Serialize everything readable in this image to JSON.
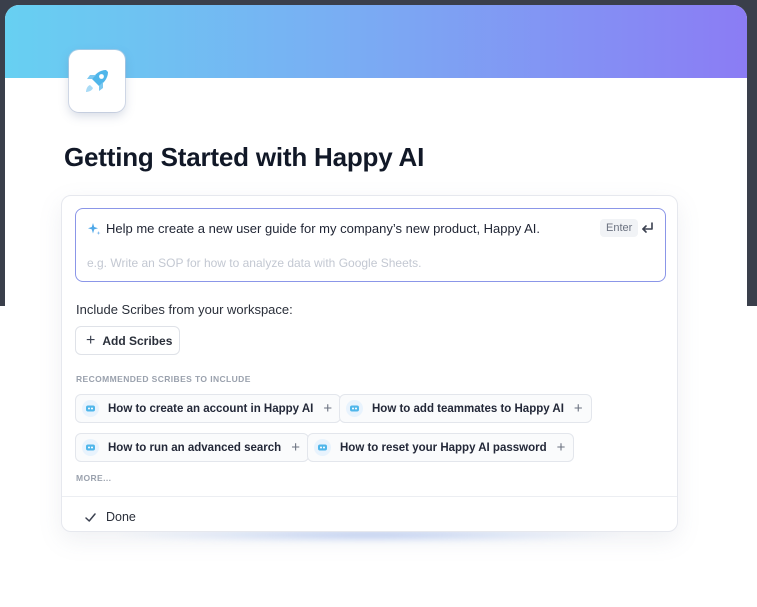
{
  "colors": {
    "banner_start": "#67d0f2",
    "banner_end": "#8b7cf4",
    "prompt_border": "#8b96e8",
    "title": "#111827"
  },
  "header": {
    "logo_icon": "rocket-icon"
  },
  "page_title": "Getting Started with Happy AI",
  "prompt": {
    "icon": "sparkle-icon",
    "value": "Help me create a new user guide for my company’s new product, Happy AI.",
    "placeholder": "e.g. Write an SOP for how to analyze data with Google Sheets.",
    "enter_label": "Enter",
    "enter_icon": "return-icon"
  },
  "scribes": {
    "include_label": "Include Scribes from your workspace:",
    "add_button_label": "Add Scribes",
    "recommended_label": "RECOMMENDED SCRIBES TO INCLUDE",
    "recommended": [
      {
        "label": "How to create an account in Happy AI"
      },
      {
        "label": "How to add teammates to Happy AI"
      },
      {
        "label": "How to run an advanced search"
      },
      {
        "label": "How to reset your Happy AI password"
      }
    ],
    "more_label": "MORE..."
  },
  "footer": {
    "done_label": "Done",
    "done_icon": "check-icon"
  }
}
